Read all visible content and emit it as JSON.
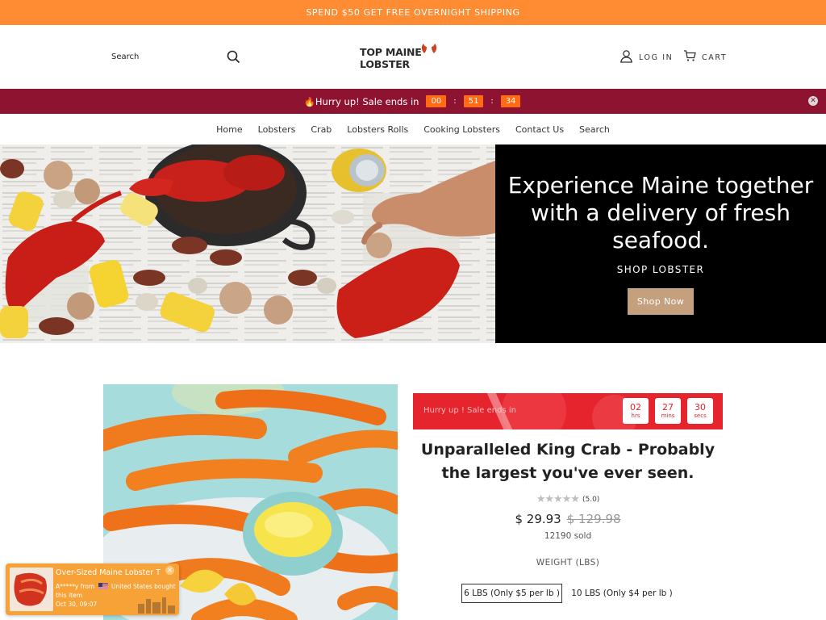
{
  "announcement": "SPEND $50 GET FREE OVERNIGHT SHIPPING",
  "header": {
    "search_label": "Search",
    "logo_text": "TOP MAINE LOBSTER",
    "login": "LOG IN",
    "cart": "CART"
  },
  "sale_bar": {
    "text": "🔥Hurry up! Sale ends in",
    "hours": "00",
    "minutes": "51",
    "seconds": "34",
    "separator": ":"
  },
  "nav": {
    "items": [
      "Home",
      "Lobsters",
      "Crab",
      "Lobsters Rolls",
      "Cooking Lobsters",
      "Contact Us",
      "Search"
    ]
  },
  "hero": {
    "title": "Experience Maine together with a delivery of fresh seafood.",
    "subtitle": "SHOP LOBSTER",
    "button": "Shop Now",
    "image_alt": "Lobster boil spread with corn, potatoes, sausage and clams on newspaper"
  },
  "product": {
    "promo_text": "Hurry up ! Sale ends in",
    "timer": [
      {
        "value": "02",
        "unit": "hrs"
      },
      {
        "value": "27",
        "unit": "mins"
      },
      {
        "value": "30",
        "unit": "secs"
      }
    ],
    "title": "Unparalleled King Crab - Probably the largest you've ever seen.",
    "stars": "★★★★★",
    "rating": "(5.0)",
    "price": "$ 29.93",
    "compare_price": "$ 129.98",
    "sold": "12190 sold",
    "option_label": "WEIGHT (LBS)",
    "options": [
      "6 LBS (Only $5 per lb )",
      "10 LBS (Only $4 per lb )"
    ]
  },
  "notification": {
    "title": "Over-Sized Maine Lobster T...",
    "buyer": "A*****y from",
    "location": "United States bought this item",
    "time": "Oct 30, 09:07"
  },
  "colors": {
    "announcement_bg": "#ff8c33",
    "sale_bar_bg": "#8e1331",
    "timer_bg": "#ff6a13",
    "hero_button": "#c4a07e",
    "promo_bg": "#e8252f",
    "notify_bg": "#f7a236"
  },
  "icons": {
    "search": "search-icon",
    "account": "user-icon",
    "cart": "cart-icon",
    "close": "close-icon"
  }
}
